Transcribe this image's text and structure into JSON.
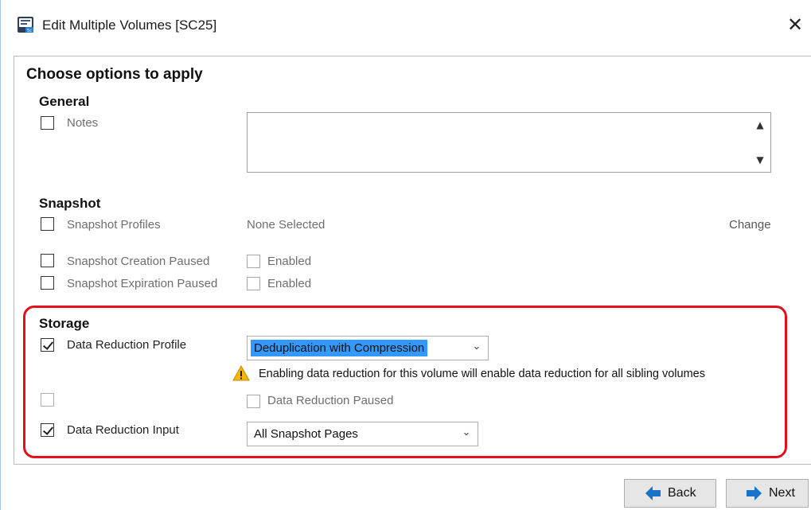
{
  "window": {
    "title": "Edit Multiple Volumes  [SC25]",
    "close_glyph": "✕",
    "icon": "storage-center-app-icon"
  },
  "main": {
    "heading": "Choose options to apply",
    "general": {
      "heading": "General",
      "notes_label": "Notes",
      "notes_checked": false,
      "notes_value": ""
    },
    "snapshot": {
      "heading": "Snapshot",
      "profiles_label": "Snapshot Profiles",
      "profiles_value": "None Selected",
      "profiles_change": "Change",
      "creation_paused_label": "Snapshot Creation Paused",
      "expiration_paused_label": "Snapshot Expiration Paused",
      "enabled_label": "Enabled"
    },
    "storage": {
      "heading": "Storage",
      "highlight_color": "#e0101c",
      "data_reduction_profile_label": "Data Reduction Profile",
      "data_reduction_profile_checked": true,
      "data_reduction_profile_value": "Deduplication with Compression",
      "warning_text": "Enabling data reduction for this volume will enable data reduction for all sibling volumes",
      "data_reduction_paused_label": "Data Reduction Paused",
      "data_reduction_input_label": "Data Reduction Input",
      "data_reduction_input_checked": true,
      "data_reduction_input_value": "All Snapshot Pages"
    }
  },
  "footer": {
    "back_label": "Back",
    "next_label": "Next",
    "arrow_color": "#1a73c8"
  }
}
